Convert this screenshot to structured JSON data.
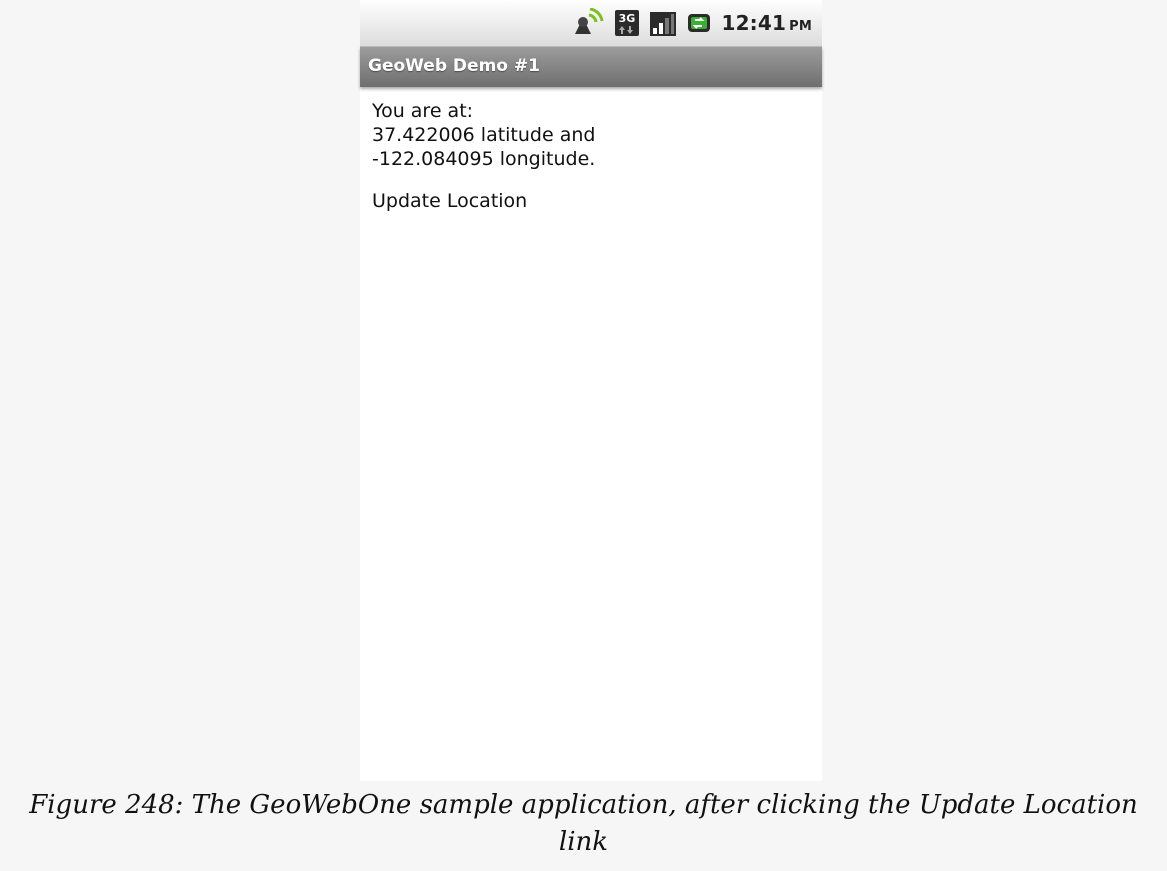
{
  "status_bar": {
    "icons": [
      "gps-signal-icon",
      "3g-data-icon",
      "signal-strength-icon",
      "battery-charging-icon"
    ],
    "time": "12:41",
    "ampm": "PM"
  },
  "app": {
    "title": "GeoWeb Demo #1"
  },
  "location": {
    "line1": "You are at:",
    "line2": "37.422006 latitude and",
    "line3": "-122.084095 longitude.",
    "update_link": "Update Location"
  },
  "caption": {
    "line1": "Figure 248: The GeoWebOne sample application, after clicking the Update Location",
    "line2": "link"
  },
  "colors": {
    "battery": "#3cb034",
    "gps": "#7cbf1f",
    "titlebar": "#7f7f7f"
  }
}
